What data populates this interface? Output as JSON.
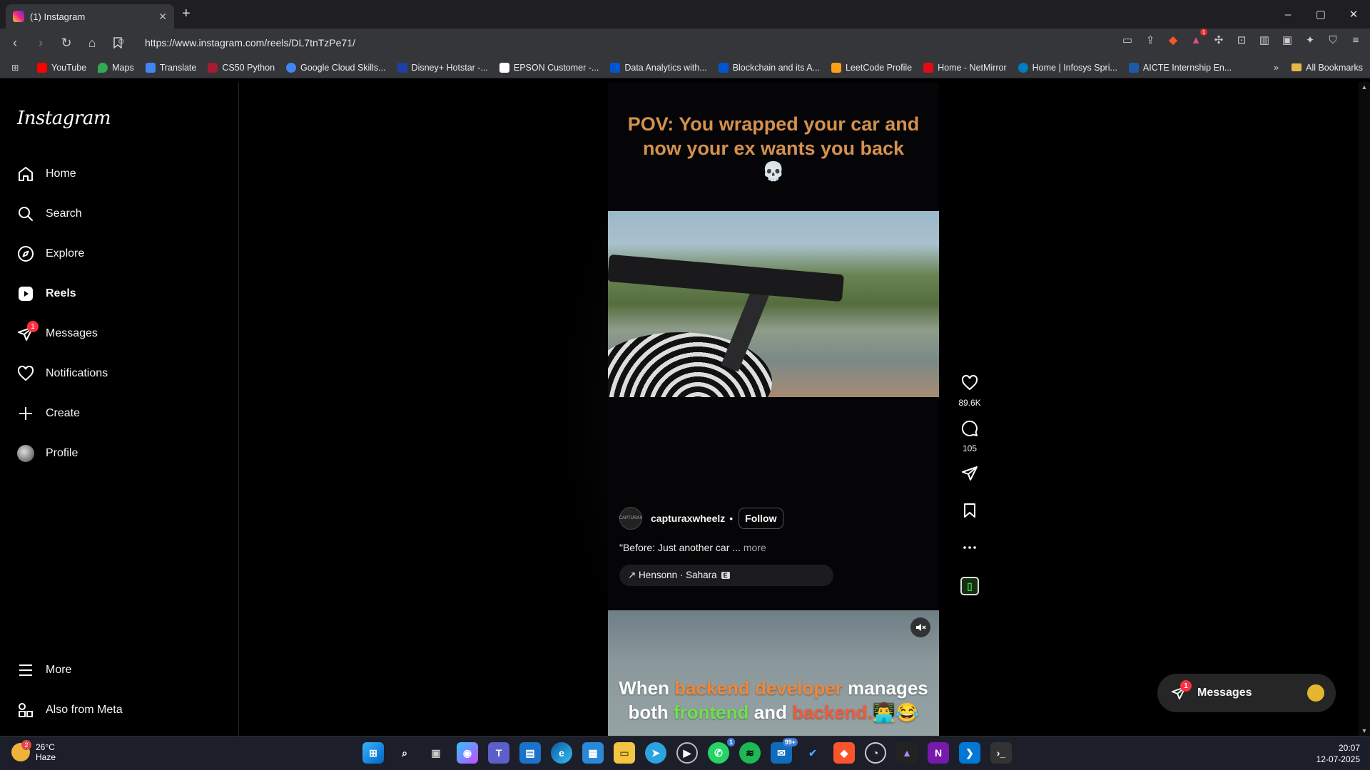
{
  "browser": {
    "tab_title": "(1) Instagram",
    "new_tab": "+",
    "url": "https://www.instagram.com/reels/DL7tnTzPe71/",
    "window_controls": [
      "–",
      "▢",
      "✕"
    ],
    "bookmarks": [
      {
        "label": "YouTube",
        "color": "#ff0000"
      },
      {
        "label": "Maps",
        "color": "#34a853"
      },
      {
        "label": "Translate",
        "color": "#4285f4"
      },
      {
        "label": "CS50 Python",
        "color": "#a51c30"
      },
      {
        "label": "Google Cloud Skills...",
        "color": "#4285f4"
      },
      {
        "label": "Disney+ Hotstar -...",
        "color": "#1f3fa8"
      },
      {
        "label": "EPSON Customer -...",
        "color": "#ffffff"
      },
      {
        "label": "Data Analytics with...",
        "color": "#0056d2"
      },
      {
        "label": "Blockchain and its A...",
        "color": "#0056d2"
      },
      {
        "label": "LeetCode Profile",
        "color": "#ffa116"
      },
      {
        "label": "Home - NetMirror",
        "color": "#e50914"
      },
      {
        "label": "Home | Infosys Spri...",
        "color": "#007cc3"
      },
      {
        "label": "AICTE Internship En...",
        "color": "#1e5aa8"
      }
    ],
    "bookmarks_overflow": "»",
    "all_bookmarks": "All Bookmarks",
    "brave_badge": "1"
  },
  "sidebar": {
    "logo": "Instagram",
    "items": [
      {
        "label": "Home"
      },
      {
        "label": "Search"
      },
      {
        "label": "Explore"
      },
      {
        "label": "Reels"
      },
      {
        "label": "Messages",
        "badge": "1"
      },
      {
        "label": "Notifications"
      },
      {
        "label": "Create"
      },
      {
        "label": "Profile"
      }
    ],
    "more": "More",
    "also_from_meta": "Also from Meta"
  },
  "reel": {
    "overlay_text": "POV: You wrapped your car and now your ex wants you back",
    "overlay_emoji": "💀",
    "username": "capturaxwheelz",
    "avatar_text": "CAPTURAX",
    "separator": "•",
    "follow": "Follow",
    "caption": "\"Before: Just another car ...",
    "caption_more": "more",
    "audio": "↗ Hensonn · Sahara",
    "explicit": "E",
    "likes": "89.6K",
    "comments": "105"
  },
  "next_reel": {
    "line1_a": "When ",
    "line1_b": "backend developer",
    "line1_c": " manages",
    "line2_a": "both ",
    "line2_b": "frontend",
    "line2_c": " and ",
    "line2_d": "backend.",
    "line2_e": "👨‍💻😂"
  },
  "messages_pill": {
    "label": "Messages",
    "badge": "1"
  },
  "taskbar": {
    "temperature": "26°C",
    "condition": "Haze",
    "weather_badge": "2",
    "whatsapp_badge": "1",
    "mail_badge": "99+",
    "time": "20:07",
    "date": "12-07-2025"
  }
}
